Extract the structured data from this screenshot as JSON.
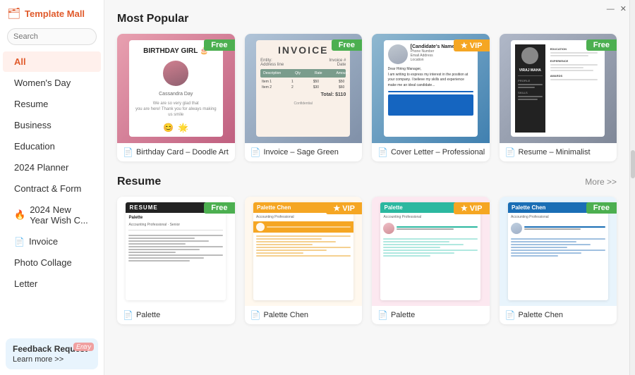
{
  "app": {
    "title": "Template Mall",
    "icon": "🔥"
  },
  "search": {
    "placeholder": "Search"
  },
  "nav": {
    "items": [
      {
        "id": "all",
        "label": "All",
        "active": true,
        "icon": null
      },
      {
        "id": "womens-day",
        "label": "Women's Day",
        "active": false,
        "icon": null
      },
      {
        "id": "resume",
        "label": "Resume",
        "active": false,
        "icon": null
      },
      {
        "id": "business",
        "label": "Business",
        "active": false,
        "icon": null
      },
      {
        "id": "education",
        "label": "Education",
        "active": false,
        "icon": null
      },
      {
        "id": "2024-planner",
        "label": "2024 Planner",
        "active": false,
        "icon": null
      },
      {
        "id": "contract-form",
        "label": "Contract & Form",
        "active": false,
        "icon": null
      },
      {
        "id": "new-year",
        "label": "2024 New Year Wish C...",
        "active": false,
        "icon": "🔥"
      },
      {
        "id": "invoice",
        "label": "Invoice",
        "active": false,
        "icon": "🔵"
      },
      {
        "id": "photo-collage",
        "label": "Photo Collage",
        "active": false,
        "icon": null
      },
      {
        "id": "letter",
        "label": "Letter",
        "active": false,
        "icon": null
      }
    ]
  },
  "feedback": {
    "title": "Feedback Request",
    "link": "Learn more >>",
    "badge": "Entry"
  },
  "window_controls": {
    "minimize": "—",
    "close": "✕"
  },
  "sections": [
    {
      "id": "most-popular",
      "title": "Most Popular",
      "show_more": false,
      "cards": [
        {
          "id": "birthday-card",
          "badge": "Free",
          "badge_type": "free",
          "label": "Birthday Card – Doodle Art",
          "bg_style": "birthday"
        },
        {
          "id": "invoice-sage",
          "badge": "Free",
          "badge_type": "free",
          "label": "Invoice – Sage Green",
          "bg_style": "invoice"
        },
        {
          "id": "cover-letter",
          "badge": "VIP",
          "badge_type": "vip",
          "label": "Cover Letter – Professional",
          "bg_style": "cover"
        },
        {
          "id": "resume-minimalist",
          "badge": "Free",
          "badge_type": "free",
          "label": "Resume – Minimalist",
          "bg_style": "resume-dark"
        }
      ]
    },
    {
      "id": "resume-section",
      "title": "Resume",
      "show_more": true,
      "more_label": "More >>",
      "cards": [
        {
          "id": "palette-free",
          "badge": "Free",
          "badge_type": "free",
          "label": "Palette",
          "sublabel": "Accounting Professional",
          "bg_style": "palette-free"
        },
        {
          "id": "palette-vip",
          "badge": "VIP",
          "badge_type": "vip",
          "label": "Palette Chen",
          "sublabel": "Accounting Professional",
          "bg_style": "palette-vip"
        },
        {
          "id": "palette-vip2",
          "badge": "VIP",
          "badge_type": "vip",
          "label": "Palette",
          "sublabel": "Accounting Professional",
          "bg_style": "palette-vip2"
        },
        {
          "id": "palette-free2",
          "badge": "Free",
          "badge_type": "free",
          "label": "Palette Chen",
          "sublabel": "Accounting Professional",
          "bg_style": "palette-free2"
        }
      ]
    }
  ]
}
